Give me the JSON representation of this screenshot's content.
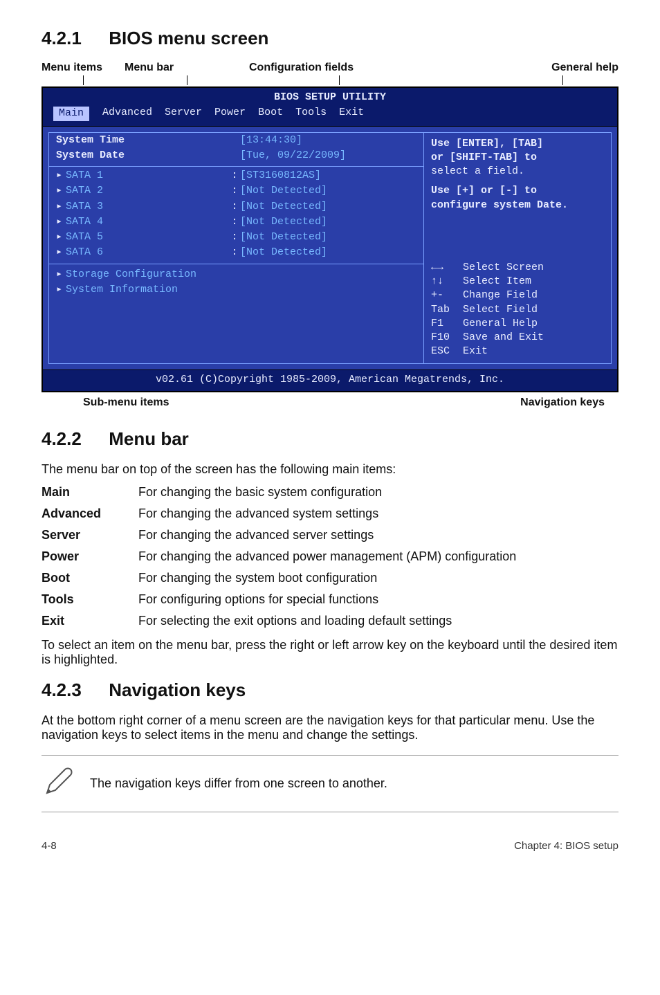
{
  "sections": {
    "s1": {
      "num": "4.2.1",
      "title": "BIOS menu screen"
    },
    "s2": {
      "num": "4.2.2",
      "title": "Menu bar"
    },
    "s3": {
      "num": "4.2.3",
      "title": "Navigation keys"
    }
  },
  "labels": {
    "menu_items": "Menu items",
    "menu_bar": "Menu bar",
    "config_fields": "Configuration fields",
    "general_help": "General help",
    "sub_menu": "Sub-menu items",
    "nav_keys": "Navigation keys"
  },
  "bios": {
    "title": "BIOS SETUP UTILITY",
    "tabs": [
      "Main",
      "Advanced",
      "Server",
      "Power",
      "Boot",
      "Tools",
      "Exit"
    ],
    "rows": {
      "time_label": "System Time",
      "time_value": "[13:44:30]",
      "date_label": "System Date",
      "date_value": "[Tue, 09/22/2009]"
    },
    "sata": [
      {
        "k": "SATA 1",
        "v": "[ST3160812AS]"
      },
      {
        "k": "SATA 2",
        "v": "[Not Detected]"
      },
      {
        "k": "SATA 3",
        "v": "[Not Detected]"
      },
      {
        "k": "SATA 4",
        "v": "[Not Detected]"
      },
      {
        "k": "SATA 5",
        "v": "[Not Detected]"
      },
      {
        "k": "SATA 6",
        "v": "[Not Detected]"
      }
    ],
    "submenus": [
      "Storage Configuration",
      "System Information"
    ],
    "help": {
      "line1": "Use [ENTER], [TAB]",
      "line2": "or [SHIFT-TAB] to",
      "line3": "select a field.",
      "line4": "Use [+] or [-] to",
      "line5": "configure system Date."
    },
    "nav": [
      {
        "key": "←→",
        "txt": "Select Screen"
      },
      {
        "key": "↑↓",
        "txt": "Select Item"
      },
      {
        "key": "+-",
        "txt": "Change Field"
      },
      {
        "key": "Tab",
        "txt": "Select Field"
      },
      {
        "key": "F1",
        "txt": "General Help"
      },
      {
        "key": "F10",
        "txt": "Save and Exit"
      },
      {
        "key": "ESC",
        "txt": "Exit"
      }
    ],
    "footer": "v02.61 (C)Copyright 1985-2009, American Megatrends, Inc."
  },
  "menubar_lead": "The menu bar on top of the screen has the following main items:",
  "defs": [
    {
      "term": "Main",
      "desc": "For changing the basic system configuration"
    },
    {
      "term": "Advanced",
      "desc": "For changing the advanced system settings"
    },
    {
      "term": "Server",
      "desc": "For changing the advanced server settings"
    },
    {
      "term": "Power",
      "desc": "For changing the advanced power management (APM) configuration"
    },
    {
      "term": "Boot",
      "desc": "For changing the system boot configuration"
    },
    {
      "term": "Tools",
      "desc": "For configuring options for special functions"
    },
    {
      "term": "Exit",
      "desc": "For selecting the exit options and loading default settings"
    }
  ],
  "menubar_tail": "To select an item on the menu bar, press the right or left arrow key on the keyboard until the desired item is highlighted.",
  "navkeys_para": "At the bottom right corner of a menu screen are the navigation keys for that particular menu. Use the navigation keys to select items in the menu and change the settings.",
  "note_text": "The navigation keys differ from one screen to another.",
  "footer": {
    "left": "4-8",
    "right": "Chapter 4: BIOS setup"
  }
}
